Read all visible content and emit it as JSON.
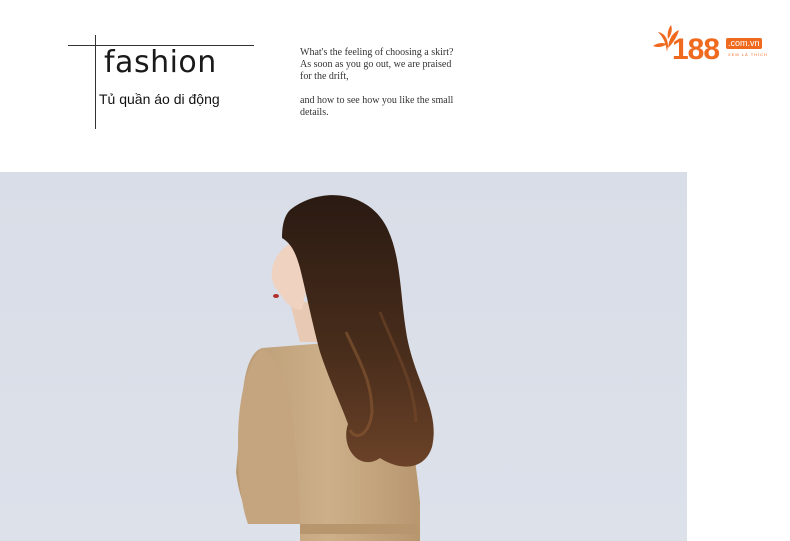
{
  "header": {
    "title": "fashion",
    "subtitle": "Tủ quần áo di động"
  },
  "quote": {
    "line1": "What's the feeling of choosing a skirt?",
    "line2": "As soon as you go out, we are praised",
    "line3": "for the drift,",
    "line4": "and how to see how you like the small",
    "line5": "details."
  },
  "logo": {
    "number": "188",
    "domain": ".com.vn",
    "tagline": "XEM LÀ THÍCH",
    "icon": "leaf-icon",
    "color": "#ef6a1f"
  },
  "photo": {
    "description_icon": "model-photo"
  }
}
